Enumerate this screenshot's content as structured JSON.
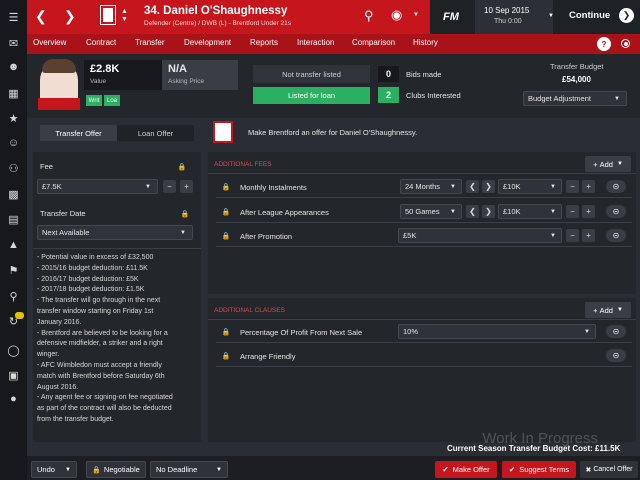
{
  "header": {
    "player_title": "34. Daniel O'Shaughnessy",
    "player_sub": "Defender (Centre) / DWB (L) - Brentford Under 21s",
    "fm_logo": "FM",
    "date": "10 Sep 2015",
    "day_time": "Thu 0:00",
    "continue_label": "Continue"
  },
  "nav": [
    "Overview",
    "Contract",
    "Transfer",
    "Development",
    "Reports",
    "Interaction",
    "Comparison",
    "History"
  ],
  "help_label": "?",
  "player_card": {
    "value": "£2.8K",
    "value_label": "Value",
    "asking": "N/A",
    "asking_label": "Asking Price",
    "tags": [
      "Wnt",
      "Loa"
    ],
    "status": "Not transfer listed",
    "listed_loan": "Listed for loan",
    "bids_count": "0",
    "bids_label": "Bids made",
    "clubs_count": "2",
    "clubs_label": "Clubs Interested",
    "budget_title": "Transfer Budget",
    "budget_value": "£54,000",
    "budget_adjust": "Budget Adjustment"
  },
  "offer_tabs": [
    "Transfer Offer",
    "Loan Offer"
  ],
  "offer_message": "Make Brentford an offer for Daniel O'Shaughnessy.",
  "left_panel": {
    "fee_label": "Fee",
    "fee_value": "£7.5K",
    "transfer_date_label": "Transfer Date",
    "transfer_date_value": "Next Available",
    "notes": [
      "- Potential value in excess of £32,500",
      "- 2015/16 budget deduction: £11.5K",
      "- 2016/17 budget deduction: £5K",
      "- 2017/18 budget deduction: £1.5K",
      "- The transfer will go through in the next",
      "transfer window starting on Friday 1st",
      "January 2016.",
      "- Brentford are believed to be looking for a",
      "defensive midfielder, a striker and a right",
      "winger.",
      "- AFC Wimbledon must accept a friendly",
      "match with Brentford before Saturday 6th",
      "August 2016.",
      "- Any agent fee or signing-on fee negotiated",
      "as part of the contract will also be deducted",
      "from the transfer budget."
    ]
  },
  "additional_fees": {
    "title": "ADDITIONAL FEES",
    "add_label": "Add",
    "rows": [
      {
        "label": "Monthly Instalments",
        "period": "24 Months",
        "amount": "£10K"
      },
      {
        "label": "After League Appearances",
        "period": "50 Games",
        "amount": "£10K"
      },
      {
        "label": "After Promotion",
        "period": "",
        "amount": "£5K"
      }
    ]
  },
  "additional_clauses": {
    "title": "ADDITIONAL CLAUSES",
    "add_label": "Add",
    "rows": [
      {
        "label": "Percentage Of Profit From Next Sale",
        "value": "10%"
      },
      {
        "label": "Arrange Friendly",
        "value": ""
      }
    ]
  },
  "footer": {
    "budget_cost": "Current Season Transfer Budget Cost: £11.5K",
    "undo": "Undo",
    "negotiable": "Negotiable",
    "deadline": "No Deadline",
    "make_offer": "Make Offer",
    "suggest_terms": "Suggest Terms",
    "cancel_offer": "Cancel Offer"
  },
  "watermark": "Work In Progress",
  "colors": {
    "accent": "#c4161c",
    "nav": "#a81218",
    "green": "#2cae63",
    "panel": "#2a2d33"
  }
}
